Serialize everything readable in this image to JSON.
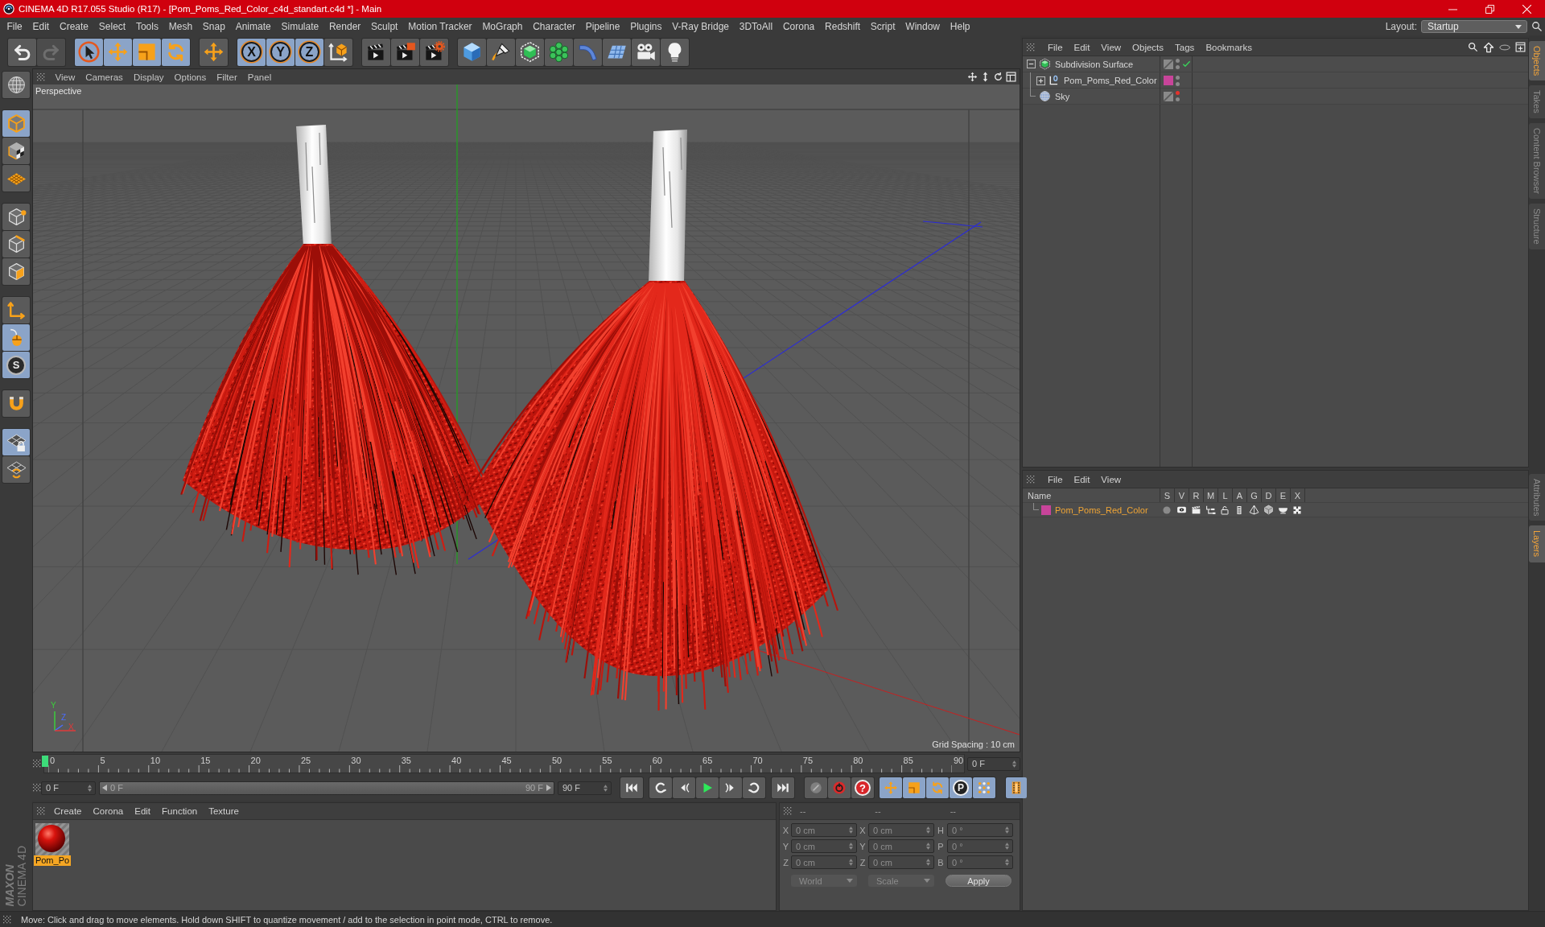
{
  "window": {
    "title": "CINEMA 4D R17.055 Studio (R17) - [Pom_Poms_Red_Color_c4d_standart.c4d *] - Main"
  },
  "menu_bar": {
    "items": [
      "File",
      "Edit",
      "Create",
      "Select",
      "Tools",
      "Mesh",
      "Snap",
      "Animate",
      "Simulate",
      "Render",
      "Sculpt",
      "Motion Tracker",
      "MoGraph",
      "Character",
      "Pipeline",
      "Plugins",
      "V-Ray Bridge",
      "3DToAll",
      "Corona",
      "Redshift",
      "Script",
      "Window",
      "Help"
    ],
    "layout_label": "Layout:",
    "layout_value": "Startup"
  },
  "toolbar": [
    [
      {
        "kind": "undo",
        "active": false,
        "disabled": false
      },
      {
        "kind": "redo",
        "active": false,
        "disabled": true
      }
    ],
    [
      {
        "kind": "select",
        "active": true
      },
      {
        "kind": "move",
        "active": true
      },
      {
        "kind": "scale",
        "active": true
      },
      {
        "kind": "rotate",
        "active": true
      }
    ],
    [
      {
        "kind": "recent-tool",
        "active": false
      }
    ],
    [
      {
        "kind": "axis-lock",
        "label": "X",
        "active": true
      },
      {
        "kind": "axis-lock",
        "label": "Y",
        "active": true
      },
      {
        "kind": "axis-lock",
        "label": "Z",
        "active": true
      },
      {
        "kind": "coordinate-system",
        "active": false
      }
    ],
    [
      {
        "kind": "render-view",
        "active": false
      },
      {
        "kind": "render-picture",
        "active": false
      },
      {
        "kind": "render-settings",
        "active": false
      }
    ],
    [
      {
        "kind": "cube",
        "active": false
      },
      {
        "kind": "pen",
        "active": false
      },
      {
        "kind": "subdivision",
        "active": false
      },
      {
        "kind": "cloner",
        "active": false
      },
      {
        "kind": "bend",
        "active": false
      },
      {
        "kind": "floor",
        "active": false
      },
      {
        "kind": "camera",
        "active": false
      },
      {
        "kind": "light",
        "active": false
      }
    ]
  ],
  "left_toolbar": [
    [
      {
        "kind": "make-editable",
        "active": false
      }
    ],
    [
      {
        "kind": "model",
        "active": true
      },
      {
        "kind": "texture",
        "active": false
      },
      {
        "kind": "workplane",
        "active": false
      }
    ],
    [
      {
        "kind": "points",
        "active": false
      },
      {
        "kind": "edges",
        "active": false
      },
      {
        "kind": "polygons",
        "active": false
      }
    ],
    [
      {
        "kind": "axis",
        "active": false
      },
      {
        "kind": "tweak",
        "active": true
      },
      {
        "kind": "snap",
        "label": "S",
        "active": true
      }
    ],
    [
      {
        "kind": "magnet",
        "active": false
      }
    ],
    [
      {
        "kind": "grid-lock",
        "active": true
      },
      {
        "kind": "grid-rotate",
        "active": false
      }
    ]
  ],
  "brand": {
    "maker": "MAXON",
    "product": "CINEMA 4D"
  },
  "viewport": {
    "menu": [
      "View",
      "Cameras",
      "Display",
      "Options",
      "Filter",
      "Panel"
    ],
    "camera": "Perspective",
    "axis_labels": [
      "Y",
      "Z",
      "X"
    ],
    "grid_spacing": "Grid Spacing : 10 cm"
  },
  "timeline": {
    "ticks": [
      "0",
      "5",
      "10",
      "15",
      "20",
      "25",
      "30",
      "35",
      "40",
      "45",
      "50",
      "55",
      "60",
      "65",
      "70",
      "75",
      "80",
      "85",
      "90"
    ],
    "level": 0,
    "current_frame": "0 F"
  },
  "playback": {
    "start": "0 F",
    "range": {
      "start": "0 F",
      "end": "90 F",
      "level": 1
    },
    "end": "90 F",
    "buttons": [
      [
        {
          "kind": "go-start"
        }
      ],
      [
        {
          "kind": "prev-key"
        },
        {
          "kind": "prev-frame"
        },
        {
          "kind": "play"
        },
        {
          "kind": "next-frame"
        },
        {
          "kind": "next-key"
        }
      ],
      [
        {
          "kind": "go-end"
        }
      ],
      [
        {
          "kind": "key-disabled",
          "active": false
        },
        {
          "kind": "record",
          "active": false
        },
        {
          "kind": "auto-key",
          "label": "?",
          "active": false
        }
      ],
      [
        {
          "kind": "key-move",
          "active": true
        },
        {
          "kind": "key-scale",
          "active": true
        },
        {
          "kind": "key-rotate",
          "active": true
        },
        {
          "kind": "key-param",
          "label": "P",
          "active": true
        },
        {
          "kind": "key-points",
          "active": true
        }
      ],
      [
        {
          "kind": "timeline-window",
          "active": true
        }
      ]
    ]
  },
  "material_manager": {
    "menu": [
      "Create",
      "Corona",
      "Edit",
      "Function",
      "Texture"
    ],
    "materials": [
      {
        "name": "Pom_Po",
        "selected": true
      }
    ]
  },
  "coordinates": {
    "headers": [
      "--",
      "--",
      "--"
    ],
    "rows": [
      {
        "axis": "X",
        "position": "0 cm",
        "size_axis": "X",
        "size": "0 cm",
        "rotation_axis": "H",
        "rotation": "0 °"
      },
      {
        "axis": "Y",
        "position": "0 cm",
        "size_axis": "Y",
        "size": "0 cm",
        "rotation_axis": "P",
        "rotation": "0 °"
      },
      {
        "axis": "Z",
        "position": "0 cm",
        "size_axis": "Z",
        "size": "0 cm",
        "rotation_axis": "B",
        "rotation": "0 °"
      }
    ],
    "space": "World",
    "mode": "Scale",
    "apply": "Apply"
  },
  "object_manager": {
    "menu": [
      "File",
      "Edit",
      "View",
      "Objects",
      "Tags",
      "Bookmarks"
    ],
    "objects": [
      {
        "name": "Subdivision Surface",
        "kind": "subdivision",
        "expanded": true,
        "checked": true,
        "editor_hidden": false,
        "children": [
          {
            "name": "Pom_Poms_Red_Color",
            "kind": "null",
            "expanded": false,
            "checked": false,
            "editor_hidden": false,
            "color": "#c8449a"
          }
        ]
      },
      {
        "name": "Sky",
        "kind": "sky",
        "checked": false,
        "editor_hidden": true
      }
    ]
  },
  "layer_manager": {
    "menu": [
      "File",
      "Edit",
      "View"
    ],
    "columns": [
      "Name",
      "S",
      "V",
      "R",
      "M",
      "L",
      "A",
      "G",
      "D",
      "E",
      "X"
    ],
    "layers": [
      {
        "name": "Pom_Poms_Red_Color",
        "color": "#c8449a"
      }
    ]
  },
  "side_tabs": {
    "upper": [
      {
        "label": "Objects",
        "selected": true
      },
      {
        "label": "Takes",
        "selected": false
      },
      {
        "label": "Content Browser",
        "selected": false
      },
      {
        "label": "Structure",
        "selected": false
      }
    ],
    "lower": [
      {
        "label": "Attributes",
        "selected": false
      },
      {
        "label": "Layers",
        "selected": true
      }
    ]
  },
  "status_bar": {
    "text": "Move: Click and drag to move elements. Hold down SHIFT to quantize movement / add to the selection in point mode, CTRL to remove."
  }
}
